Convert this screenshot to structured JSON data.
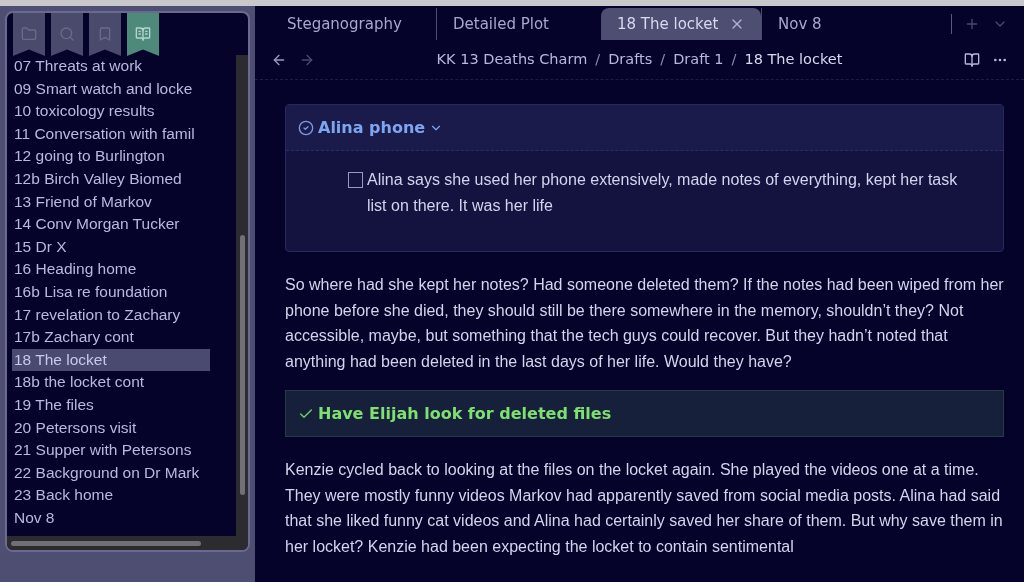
{
  "sidebar": {
    "tabs": [
      {
        "kind": "folder",
        "selected": false
      },
      {
        "kind": "search",
        "selected": false
      },
      {
        "kind": "bookmark",
        "selected": false
      },
      {
        "kind": "book",
        "selected": true
      }
    ],
    "items": [
      {
        "label": "07 Threats at work",
        "selected": false
      },
      {
        "label": "09 Smart watch and locke",
        "selected": false
      },
      {
        "label": "10 toxicology results",
        "selected": false
      },
      {
        "label": "11 Conversation with famil",
        "selected": false
      },
      {
        "label": "12 going to Burlington",
        "selected": false
      },
      {
        "label": "12b Birch Valley Biomed",
        "selected": false
      },
      {
        "label": "13 Friend of Markov",
        "selected": false
      },
      {
        "label": "14 Conv Morgan Tucker",
        "selected": false
      },
      {
        "label": "15 Dr X",
        "selected": false
      },
      {
        "label": "16 Heading home",
        "selected": false
      },
      {
        "label": "16b Lisa re foundation",
        "selected": false
      },
      {
        "label": "17 revelation to Zachary",
        "selected": false
      },
      {
        "label": "17b Zachary cont",
        "selected": false
      },
      {
        "label": "18 The locket",
        "selected": true
      },
      {
        "label": "18b the locket cont",
        "selected": false
      },
      {
        "label": "19 The files",
        "selected": false
      },
      {
        "label": "20 Petersons visit",
        "selected": false
      },
      {
        "label": "21 Supper with Petersons",
        "selected": false
      },
      {
        "label": "22 Background on Dr Mark",
        "selected": false
      },
      {
        "label": "23 Back home",
        "selected": false
      },
      {
        "label": "Nov 8",
        "selected": false
      }
    ]
  },
  "tabs": [
    {
      "label": "Steganography",
      "selected": false
    },
    {
      "label": "Detailed Plot",
      "selected": false
    },
    {
      "label": "18 The locket",
      "selected": true
    },
    {
      "label": "Nov 8",
      "selected": false
    }
  ],
  "breadcrumb": {
    "separator": "/",
    "items": [
      "KK 13 Deaths Charm",
      "Drafts",
      "Draft 1",
      "18 The locket"
    ]
  },
  "content": [
    {
      "kind": "callout",
      "title": "Alina phone",
      "text": "Alina says she used her phone extensively, made notes of everything, kept her task list on there. It was her life",
      "checked": false
    },
    {
      "kind": "paragraph",
      "text": "So where had she kept her notes? Had someone deleted them? If the notes had been wiped from her phone before she died, they should still be there somewhere in the memory, shouldn’t they? Not accessible, maybe, but something that the tech guys could recover. But they hadn’t noted that anything had been deleted in the last days of her life. Would they have?"
    },
    {
      "kind": "success",
      "title": "Have Elijah look for deleted files"
    },
    {
      "kind": "paragraph",
      "text": "Kenzie cycled back to looking at the files on the locket again. She played the videos one at a time. They were mostly funny videos Markov had apparently saved from social media posts. Alina had said that she liked funny cat videos and Alina had certainly saved her share of them. But why save them in her locket? Kenzie had been expecting the locket to contain sentimental"
    }
  ]
}
